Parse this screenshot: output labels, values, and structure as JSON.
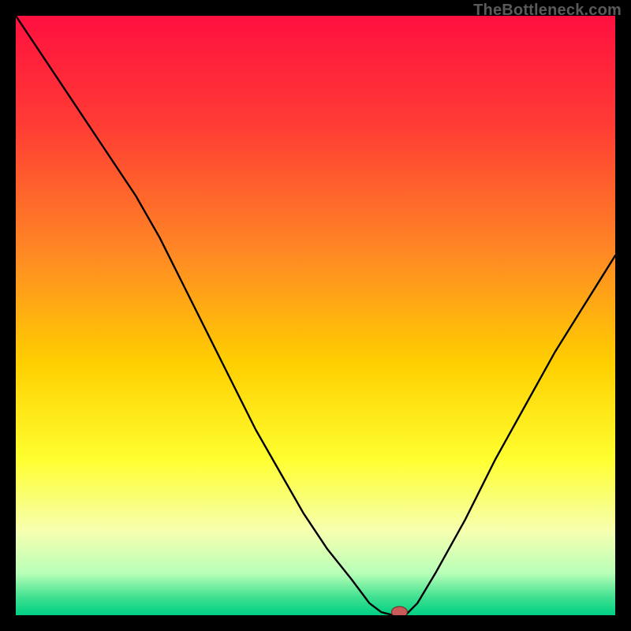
{
  "watermark": "TheBottleneck.com",
  "gradient_stops": [
    {
      "offset": "0%",
      "color": "#ff1040"
    },
    {
      "offset": "18%",
      "color": "#ff3b34"
    },
    {
      "offset": "40%",
      "color": "#ff8a24"
    },
    {
      "offset": "58%",
      "color": "#ffcf00"
    },
    {
      "offset": "74%",
      "color": "#ffff30"
    },
    {
      "offset": "86%",
      "color": "#f6ffb0"
    },
    {
      "offset": "93%",
      "color": "#b8ffb8"
    },
    {
      "offset": "97%",
      "color": "#40e090"
    },
    {
      "offset": "100%",
      "color": "#00d084"
    }
  ],
  "chart_data": {
    "type": "line",
    "title": "",
    "xlabel": "",
    "ylabel": "",
    "xlim": [
      0,
      100
    ],
    "ylim": [
      0,
      100
    ],
    "curve": {
      "x": [
        0,
        4,
        8,
        12,
        16,
        20,
        24,
        28,
        32,
        36,
        40,
        44,
        48,
        52,
        56,
        59,
        61,
        63,
        65,
        67,
        70,
        75,
        80,
        85,
        90,
        95,
        100
      ],
      "bottleneck": [
        100,
        94,
        88,
        82,
        76,
        70,
        63,
        55,
        47,
        39,
        31,
        24,
        17,
        11,
        6,
        2,
        0.5,
        0,
        0,
        2,
        7,
        16,
        26,
        35,
        44,
        52,
        60
      ]
    },
    "optimum": {
      "x": 64,
      "bottleneck": 0
    },
    "marker_color": "#c85a5a"
  }
}
